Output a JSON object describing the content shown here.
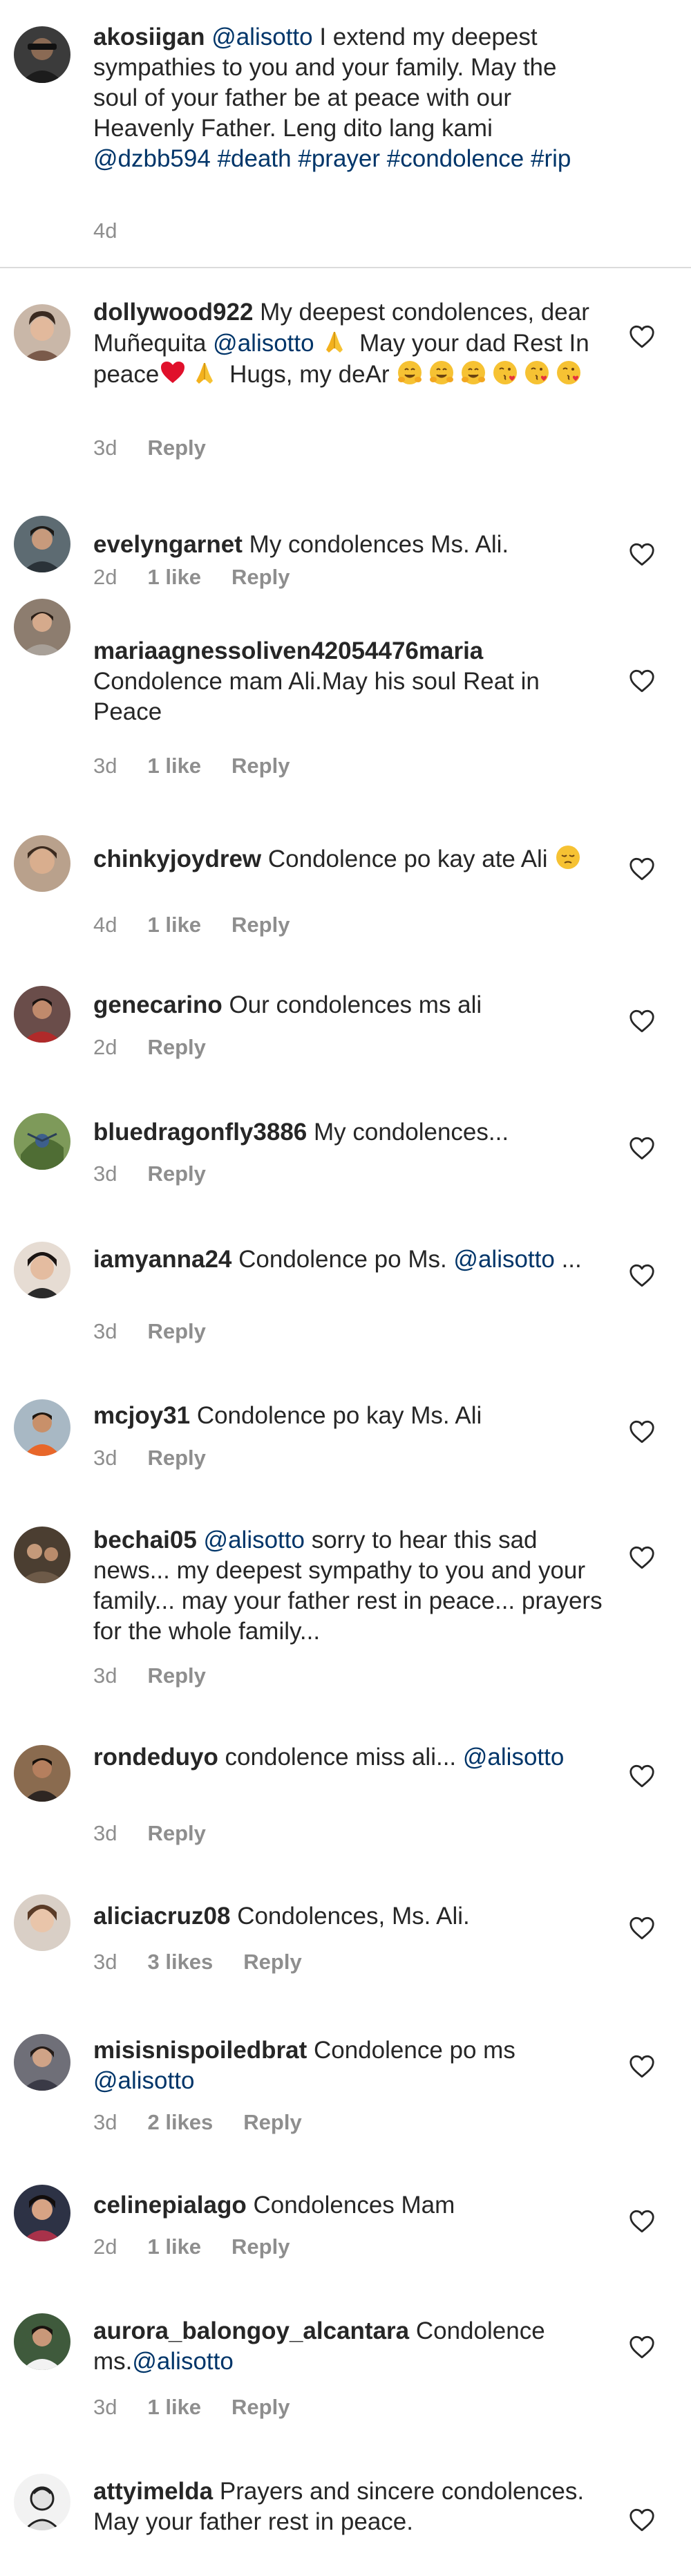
{
  "colors": {
    "username": "#262626",
    "text": "#262626",
    "link": "#003569",
    "meta": "#8e8e8e",
    "separator": "#dbdbdb"
  },
  "reply_label": "Reply",
  "caption": {
    "user": "akosiigan",
    "mention": "@alisotto",
    "text_1": " I extend my deepest sympathies to you and your family. May the soul of your father be at peace with our Heavenly Father. Leng dito lang kami ",
    "mention_2": "@dzbb594",
    "tag_death": "#death",
    "tag_prayer": "#prayer",
    "tag_condolence": "#condolence",
    "tag_rip": "#rip",
    "time": "4d"
  },
  "comments": [
    {
      "user": "dollywood922",
      "text_1": " My deepest condolences, dear Muñequita ",
      "mention": "@alisotto",
      "text_2": " May your dad Rest In peace",
      "text_3": " Hugs, my deAr",
      "time": "3d",
      "likes": ""
    },
    {
      "user": "evelyngarnet",
      "text": " My condolences Ms. Ali.",
      "time": "2d",
      "likes": "1 like"
    },
    {
      "user": "mariaagnessoliven42054476maria",
      "text": " Condolence mam Ali.May his soul Reat in Peace",
      "time": "3d",
      "likes": "1 like"
    },
    {
      "user": "chinkyjoydrew",
      "text": " Condolence po kay ate Ali",
      "time": "4d",
      "likes": "1 like"
    },
    {
      "user": "genecarino",
      "text": " Our condolences ms ali",
      "time": "2d",
      "likes": ""
    },
    {
      "user": "bluedragonfly3886",
      "text": " My condolences...",
      "time": "3d",
      "likes": ""
    },
    {
      "user": "iamyanna24",
      "text": " Condolence po Ms. ",
      "mention": "@alisotto",
      "text_after": " ...",
      "time": "3d",
      "likes": ""
    },
    {
      "user": "mcjoy31",
      "text": " Condolence po kay Ms. Ali",
      "time": "3d",
      "likes": ""
    },
    {
      "user": "bechai05",
      "mention": "@alisotto",
      "text_after": " sorry to hear this sad news... my deepest sympathy to you and your family... may your father rest in peace... prayers for the whole family...",
      "time": "3d",
      "likes": ""
    },
    {
      "user": "rondeduyo",
      "text": " condolence miss ali... ",
      "mention": "@alisotto",
      "time": "3d",
      "likes": ""
    },
    {
      "user": "aliciacruz08",
      "text": " Condolences, Ms. Ali.",
      "time": "3d",
      "likes": "3 likes"
    },
    {
      "user": "misisnispoiledbrat",
      "text": " Condolence po ms ",
      "mention": "@alisotto",
      "time": "3d",
      "likes": "2 likes"
    },
    {
      "user": "celinepialago",
      "text": " Condolences Mam",
      "time": "2d",
      "likes": "1 like"
    },
    {
      "user": "aurora_balongoy_alcantara",
      "text": " Condolence ms.",
      "mention": "@alisotto",
      "time": "3d",
      "likes": "1 like"
    },
    {
      "user": "attyimelda",
      "text": " Prayers and sincere condolences. May your father rest in peace.",
      "time": "",
      "likes": ""
    }
  ],
  "icons": {
    "like": "heart-outline-icon",
    "folded_hands": "folded-hands-emoji",
    "red_heart": "red-heart-emoji",
    "hugging_face": "hugging-face-emoji",
    "kissing_face": "face-blowing-kiss-emoji",
    "pensive_face": "pensive-face-emoji"
  }
}
